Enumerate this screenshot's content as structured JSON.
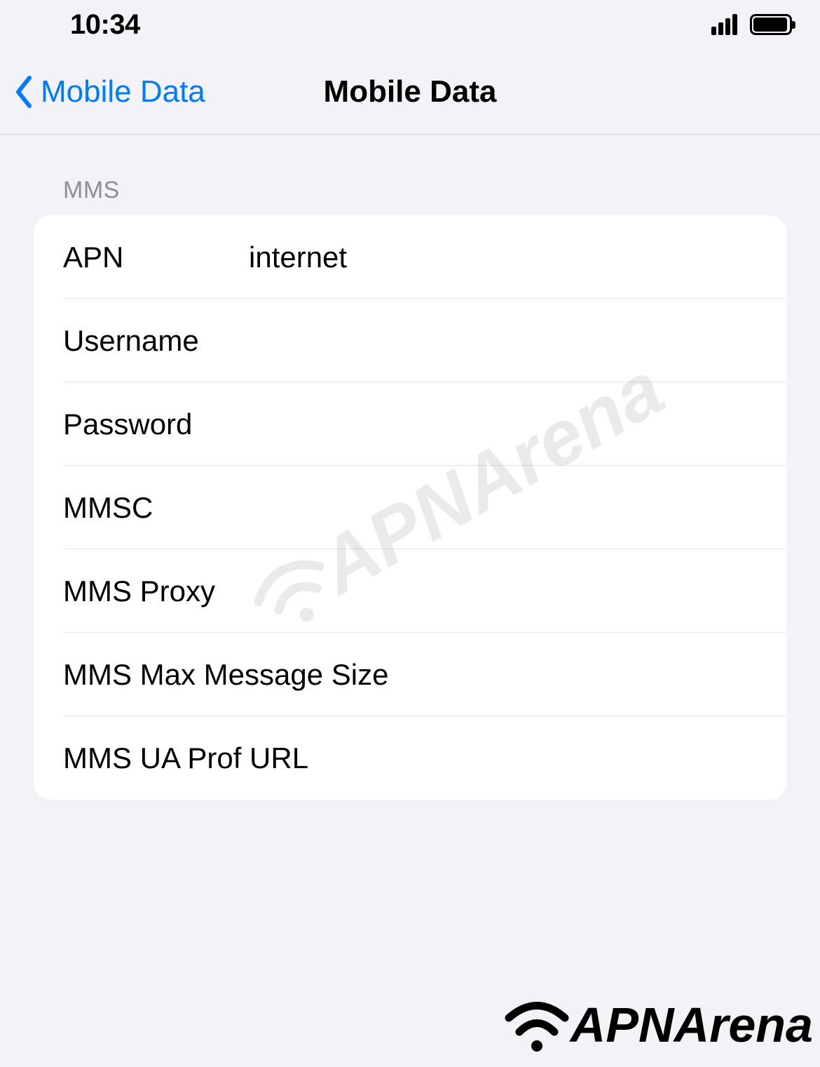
{
  "status_bar": {
    "time": "10:34"
  },
  "nav": {
    "back_label": "Mobile Data",
    "title": "Mobile Data"
  },
  "section": {
    "header": "MMS",
    "rows": {
      "apn": {
        "label": "APN",
        "value": "internet"
      },
      "username": {
        "label": "Username",
        "value": ""
      },
      "password": {
        "label": "Password",
        "value": ""
      },
      "mmsc": {
        "label": "MMSC",
        "value": ""
      },
      "mms_proxy": {
        "label": "MMS Proxy",
        "value": ""
      },
      "mms_max_size": {
        "label": "MMS Max Message Size",
        "value": ""
      },
      "mms_ua_prof": {
        "label": "MMS UA Prof URL",
        "value": ""
      }
    }
  },
  "watermark": {
    "text": "APNArena"
  },
  "footer": {
    "text": "APNArena"
  }
}
